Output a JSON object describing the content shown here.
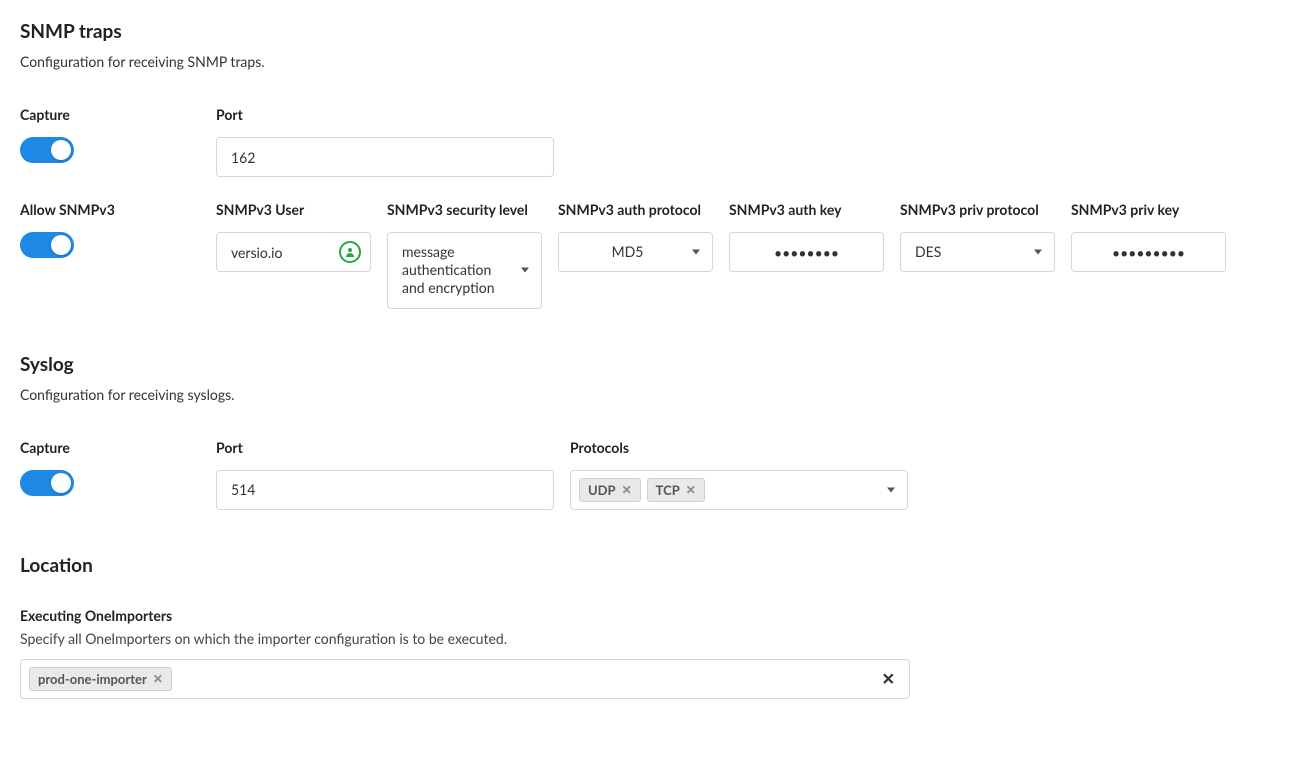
{
  "snmp": {
    "title": "SNMP traps",
    "desc": "Configuration for receiving SNMP traps.",
    "capture_label": "Capture",
    "port_label": "Port",
    "port_value": "162",
    "allow_v3_label": "Allow SNMPv3",
    "user_label": "SNMPv3 User",
    "user_value": "versio.io",
    "sec_level_label": "SNMPv3 security level",
    "sec_level_value": "message authentication and encryption",
    "auth_proto_label": "SNMPv3 auth protocol",
    "auth_proto_value": "MD5",
    "auth_key_label": "SNMPv3 auth key",
    "auth_key_value": "••••••••",
    "priv_proto_label": "SNMPv3 priv protocol",
    "priv_proto_value": "DES",
    "priv_key_label": "SNMPv3 priv key",
    "priv_key_value": "•••••••••"
  },
  "syslog": {
    "title": "Syslog",
    "desc": "Configuration for receiving syslogs.",
    "capture_label": "Capture",
    "port_label": "Port",
    "port_value": "514",
    "protocols_label": "Protocols",
    "protocols": [
      "UDP",
      "TCP"
    ]
  },
  "location": {
    "title": "Location",
    "sub_label": "Executing OneImporters",
    "sub_desc": "Specify all OneImporters on which the importer configuration is to be executed.",
    "tags": [
      "prod-one-importer"
    ]
  }
}
